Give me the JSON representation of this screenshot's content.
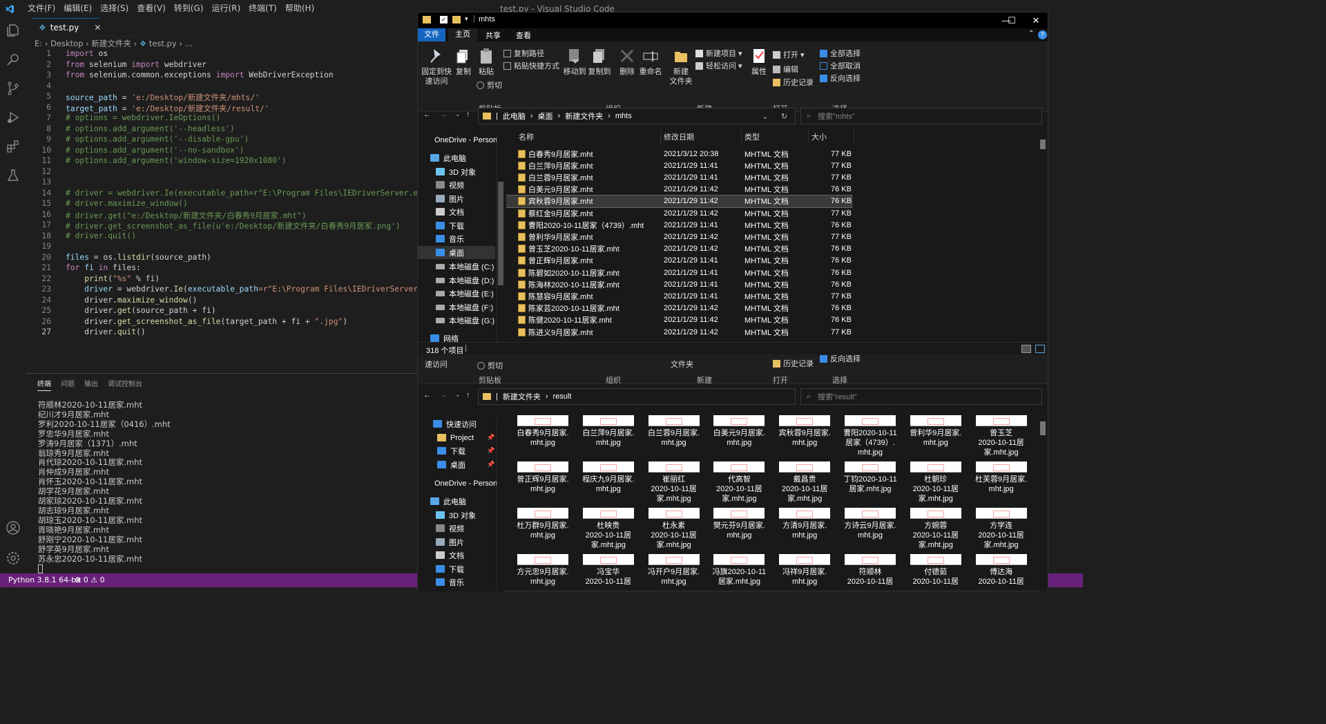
{
  "vscode": {
    "menu": [
      "文件(F)",
      "编辑(E)",
      "选择(S)",
      "查看(V)",
      "转到(G)",
      "运行(R)",
      "终端(T)",
      "帮助(H)"
    ],
    "window_title": "test.py - Visual Studio Code",
    "tab_label": "test.py",
    "breadcrumb": [
      "E:",
      "Desktop",
      "新建文件夹",
      "test.py",
      "..."
    ],
    "code_lines": [
      {
        "n": "1"
      },
      {
        "n": "2"
      },
      {
        "n": "3"
      },
      {
        "n": "4"
      },
      {
        "n": "5"
      },
      {
        "n": "6"
      },
      {
        "n": "7"
      },
      {
        "n": "8"
      },
      {
        "n": "9"
      },
      {
        "n": "10"
      },
      {
        "n": "11"
      },
      {
        "n": "12"
      },
      {
        "n": "13"
      },
      {
        "n": "14"
      },
      {
        "n": "15"
      },
      {
        "n": "16"
      },
      {
        "n": "17"
      },
      {
        "n": "18"
      },
      {
        "n": "19"
      },
      {
        "n": "20"
      },
      {
        "n": "21"
      },
      {
        "n": "22"
      },
      {
        "n": "23"
      },
      {
        "n": "24"
      },
      {
        "n": "25"
      },
      {
        "n": "26"
      },
      {
        "n": "27"
      }
    ],
    "code": {
      "l1a": "import",
      "l1b": " os",
      "l2a": "from",
      "l2b": " selenium ",
      "l2c": "import",
      "l2d": " webdriver",
      "l3a": "from",
      "l3b": " selenium.common.exceptions ",
      "l3c": "import",
      "l3d": " WebDriverException",
      "l5a": "source_path",
      "l5b": " = ",
      "l5c": "'e:/Desktop/新建文件夹/mhts/'",
      "l6a": "target_path",
      "l6b": " = ",
      "l6c": "'e:/Desktop/新建文件夹/result/'",
      "l7": "# options = webdriver.IeOptions()",
      "l8": "# options.add_argument('--headless')",
      "l9": "# options.add_argument('--disable-gpu')",
      "l10": "# options.add_argument('--no-sandbox')",
      "l11": "# options.add_argument('window-size=1920x1080')",
      "l14": "# driver = webdriver.Ie(executable_path=r\"E:\\Program Files\\IEDriverServer.exe\")",
      "l15": "# driver.maximize_window()",
      "l16": "# driver.get(\"e:/Desktop/新建文件夹/白春秀9月居家.mht\")",
      "l17": "# driver.get_screenshot_as_file(u'e:/Desktop/新建文件夹/白春秀9月居家.png')",
      "l18": "# driver.quit()",
      "l20a": "files",
      "l20b": " = os.",
      "l20c": "listdir",
      "l20d": "(source_path)",
      "l21a": "for",
      "l21b": " fi ",
      "l21c": "in",
      "l21d": " files:",
      "l22a": "    print",
      "l22b": "(",
      "l22c": "\"%s\"",
      "l22d": " % fi)",
      "l23a": "    driver",
      "l23b": " = webdriver.",
      "l23c": "Ie",
      "l23d": "(",
      "l23e": "executable_path",
      "l23f": "=r\"E:\\Program Files\\IEDriverServer.exe\")",
      "l24a": "    driver.",
      "l24b": "maximize_window",
      "l24c": "()",
      "l25a": "    driver.",
      "l25b": "get",
      "l25c": "(source_path + fi)",
      "l26a": "    driver.",
      "l26b": "get_screenshot_as_file",
      "l26c": "(target_path + fi + ",
      "l26d": "\".jpg\"",
      "l26e": ")",
      "l27a": "    driver.",
      "l27b": "quit",
      "l27c": "()"
    },
    "panel_tabs": [
      "终端",
      "问题",
      "输出",
      "调试控制台"
    ],
    "terminal_lines": "符顺林2020-10-11居家.mht\n纪川才9月居家.mht\n罗利2020-10-11居家（0416）.mht\n罗忠华9月居家.mht\n罗涛9月居家（1371）.mht\n翁琼秀9月居家.mht\n肖代琼2020-10-11居家.mht\n肖仲成9月居家.mht\n肖怀玉2020-10-11居家.mht\n胡学花9月居家.mht\n胡家琼2020-10-11居家.mht\n胡志琼9月居家.mht\n胡琼玉2020-10-11居家.mht\n胥晓艳9月居家.mht\n舒刚宁2020-10-11居家.mht\n舒学英9月居家.mht\n苏永忠2020-10-11居家.mht",
    "status": {
      "python": "Python 3.8.1 64-bit",
      "problems": "⊗ 0 ⚠ 0"
    }
  },
  "explorer1": {
    "title": "mhts",
    "ribbon_tabs": [
      "文件",
      "主页",
      "共享",
      "查看"
    ],
    "ribbon": {
      "pin": "固定到快\n速访问",
      "copy": "复制",
      "paste": "粘贴",
      "copy_path": "复制路径",
      "paste_shortcut": "粘贴快捷方式",
      "cut": "剪切",
      "move_to": "移动到",
      "copy_to": "复制到",
      "delete": "删除",
      "rename": "重命名",
      "new_folder": "新建\n文件夹",
      "new_item": "新建项目",
      "easy_access": "轻松访问",
      "properties": "属性",
      "open": "打开",
      "edit": "编辑",
      "history": "历史记录",
      "select_all": "全部选择",
      "select_none": "全部取消",
      "invert": "反向选择",
      "groups": [
        "剪贴板",
        "组织",
        "新建",
        "打开",
        "选择"
      ]
    },
    "address": [
      "此电脑",
      "桌面",
      "新建文件夹",
      "mhts"
    ],
    "search_placeholder": "搜索\"mhts\"",
    "nav": [
      "OneDrive - Person",
      "此电脑",
      "3D 对象",
      "视频",
      "图片",
      "文档",
      "下载",
      "音乐",
      "桌面",
      "本地磁盘 (C:)",
      "本地磁盘 (D:)",
      "本地磁盘 (E:)",
      "本地磁盘 (F:)",
      "本地磁盘 (G:)",
      "网络"
    ],
    "columns": [
      "名称",
      "修改日期",
      "类型",
      "大小"
    ],
    "files": [
      {
        "name": "白春秀9月居家.mht",
        "date": "2021/3/12 20:38",
        "type": "MHTML 文档",
        "size": "77 KB"
      },
      {
        "name": "白兰萍9月居家.mht",
        "date": "2021/1/29 11:41",
        "type": "MHTML 文档",
        "size": "77 KB"
      },
      {
        "name": "白兰蓉9月居家.mht",
        "date": "2021/1/29 11:41",
        "type": "MHTML 文档",
        "size": "77 KB"
      },
      {
        "name": "白美元9月居家.mht",
        "date": "2021/1/29 11:42",
        "type": "MHTML 文档",
        "size": "76 KB"
      },
      {
        "name": "宾秋蓉9月居家.mht",
        "date": "2021/1/29 11:42",
        "type": "MHTML 文档",
        "size": "76 KB"
      },
      {
        "name": "蔡红金9月居家.mht",
        "date": "2021/1/29 11:42",
        "type": "MHTML 文档",
        "size": "77 KB"
      },
      {
        "name": "曹阳2020-10-11居家（4739）.mht",
        "date": "2021/1/29 11:41",
        "type": "MHTML 文档",
        "size": "76 KB"
      },
      {
        "name": "曾利华9月居家.mht",
        "date": "2021/1/29 11:42",
        "type": "MHTML 文档",
        "size": "77 KB"
      },
      {
        "name": "曾玉芝2020-10-11居家.mht",
        "date": "2021/1/29 11:42",
        "type": "MHTML 文档",
        "size": "76 KB"
      },
      {
        "name": "曾正辉9月居家.mht",
        "date": "2021/1/29 11:41",
        "type": "MHTML 文档",
        "size": "76 KB"
      },
      {
        "name": "陈碧如2020-10-11居家.mht",
        "date": "2021/1/29 11:41",
        "type": "MHTML 文档",
        "size": "76 KB"
      },
      {
        "name": "陈海林2020-10-11居家.mht",
        "date": "2021/1/29 11:41",
        "type": "MHTML 文档",
        "size": "76 KB"
      },
      {
        "name": "陈慧容9月居家.mht",
        "date": "2021/1/29 11:41",
        "type": "MHTML 文档",
        "size": "77 KB"
      },
      {
        "name": "陈家芸2020-10-11居家.mht",
        "date": "2021/1/29 11:42",
        "type": "MHTML 文档",
        "size": "76 KB"
      },
      {
        "name": "陈健2020-10-11居家.mht",
        "date": "2021/1/29 11:42",
        "type": "MHTML 文档",
        "size": "76 KB"
      },
      {
        "name": "陈进义9月居家.mht",
        "date": "2021/1/29 11:42",
        "type": "MHTML 文档",
        "size": "77 KB"
      }
    ],
    "item_count": "318 个项目"
  },
  "explorer2": {
    "ribbon": {
      "pin": "速访问",
      "cut": "剪切",
      "new_folder": "文件夹",
      "history": "历史记录",
      "invert": "反向选择",
      "groups": [
        "剪贴板",
        "组织",
        "新建",
        "打开",
        "选择"
      ]
    },
    "address": [
      "新建文件夹",
      "result"
    ],
    "search_placeholder": "搜索\"result\"",
    "nav": [
      "快速访问",
      "Project",
      "下载",
      "桌面",
      "OneDrive - Person",
      "此电脑",
      "3D 对象",
      "视频",
      "图片",
      "文档",
      "下载",
      "音乐"
    ],
    "thumbs": [
      "白春秀9月居家.\nmht.jpg",
      "白兰萍9月居家.\nmht.jpg",
      "白兰蓉9月居家.\nmht.jpg",
      "白美元9月居家.\nmht.jpg",
      "宾秋蓉9月居家.\nmht.jpg",
      "曹阳2020-10-11\n居家（4739）.\nmht.jpg",
      "曾利华9月居家.\nmht.jpg",
      "曾玉芝\n2020-10-11居\n家.mht.jpg",
      "曾正辉9月居家.\nmht.jpg",
      "程庆九9月居家.\nmht.jpg",
      "崔丽红\n2020-10-11居\n家.mht.jpg",
      "代高智\n2020-10-11居\n家.mht.jpg",
      "戴昌贵\n2020-10-11居\n家.mht.jpg",
      "丁钧2020-10-11\n居家.mht.jpg",
      "杜朝珍\n2020-10-11居\n家.mht.jpg",
      "杜芙蓉9月居家.\nmht.jpg",
      "杜万群9月居家.\nmht.jpg",
      "杜映贵\n2020-10-11居\n家.mht.jpg",
      "杜永素\n2020-10-11居\n家.mht.jpg",
      "樊元芬9月居家.\nmht.jpg",
      "方清9月居家.\nmht.jpg",
      "方诗云9月居家.\nmht.jpg",
      "方婉蓉\n2020-10-11居\n家.mht.jpg",
      "方学连\n2020-10-11居\n家.mht.jpg",
      "方元忠9月居家.\nmht.jpg",
      "冯宝华\n2020-10-11居",
      "冯开户9月居家.\nmht.jpg",
      "冯旗2020-10-11\n居家.mht.jpg",
      "冯祥9月居家.\nmht.jpg",
      "符顺林\n2020-10-11居",
      "付德茹\n2020-10-11居",
      "傅达海\n2020-10-11居"
    ]
  },
  "colors": {
    "statusbar": "#68217a",
    "accent": "#0e639c",
    "explorer_bg": "#191919"
  }
}
